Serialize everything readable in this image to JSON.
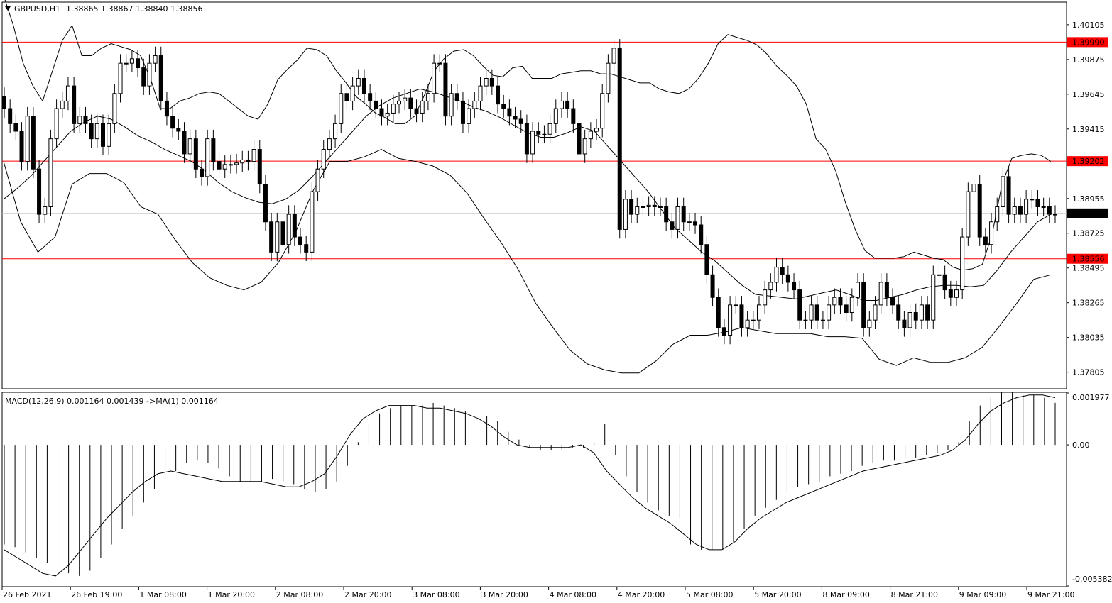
{
  "window": {
    "symbol_title": "GBPUSD,H1",
    "ohlc": "1.38865 1.38867 1.38840 1.38856",
    "indicator_title": "MACD(12,26,9) 0.001164 0.001439  ->MA(1) 0.001164"
  },
  "colors": {
    "background": "#ffffff",
    "candle": "#000000",
    "level_line": "#ff0000",
    "level_label_bg": "#ff0000",
    "current_price_bg": "#000000"
  },
  "chart_data": [
    {
      "type": "candlestick",
      "title": "GBPUSD,H1",
      "ylim": [
        1.377,
        1.4025
      ],
      "y_ticks": [
        "1.40105",
        "1.39875",
        "1.39645",
        "1.39415",
        "1.38955",
        "1.38725",
        "1.38495",
        "1.38265",
        "1.38035",
        "1.37805"
      ],
      "x_ticks": [
        "26 Feb 2021",
        "26 Feb 19:00",
        "1 Mar 08:00",
        "1 Mar 20:00",
        "2 Mar 08:00",
        "2 Mar 20:00",
        "3 Mar 08:00",
        "3 Mar 20:00",
        "4 Mar 08:00",
        "4 Mar 20:00",
        "5 Mar 08:00",
        "5 Mar 20:00",
        "8 Mar 09:00",
        "8 Mar 21:00",
        "9 Mar 09:00",
        "9 Mar 21:00"
      ],
      "levels": [
        {
          "value": 1.3999,
          "label": "1.39990"
        },
        {
          "value": 1.39202,
          "label": "1.39202"
        },
        {
          "value": 1.38556,
          "label": "1.38556"
        }
      ],
      "current_price": {
        "value": 1.38856,
        "label": "1.38856"
      },
      "close": [
        1.3955,
        1.3945,
        1.394,
        1.392,
        1.395,
        1.3915,
        1.3885,
        1.389,
        1.3935,
        1.3955,
        1.396,
        1.397,
        1.3945,
        1.395,
        1.3945,
        1.3935,
        1.3945,
        1.393,
        1.3945,
        1.3965,
        1.3985,
        1.3985,
        1.3988,
        1.3982,
        1.397,
        1.3985,
        1.399,
        1.396,
        1.395,
        1.3942,
        1.394,
        1.3925,
        1.3935,
        1.3915,
        1.391,
        1.3935,
        1.392,
        1.3915,
        1.3918,
        1.3918,
        1.3919,
        1.3921,
        1.392,
        1.3928,
        1.3905,
        1.388,
        1.386,
        1.388,
        1.3865,
        1.3885,
        1.387,
        1.3865,
        1.386,
        1.39,
        1.3915,
        1.3928,
        1.3935,
        1.3945,
        1.3965,
        1.396,
        1.397,
        1.3975,
        1.3965,
        1.396,
        1.3955,
        1.395,
        1.3952,
        1.3958,
        1.396,
        1.3962,
        1.3955,
        1.3952,
        1.396,
        1.3965,
        1.3985,
        1.3985,
        1.395,
        1.3965,
        1.396,
        1.3945,
        1.3955,
        1.396,
        1.397,
        1.3975,
        1.397,
        1.3958,
        1.3955,
        1.395,
        1.3948,
        1.3945,
        1.3925,
        1.394,
        1.3938,
        1.3938,
        1.3945,
        1.3955,
        1.396,
        1.3955,
        1.3945,
        1.3925,
        1.3935,
        1.394,
        1.3942,
        1.3965,
        1.3985,
        1.3995,
        1.3875,
        1.3895,
        1.3885,
        1.389,
        1.389,
        1.3891,
        1.389,
        1.389,
        1.388,
        1.3875,
        1.389,
        1.388,
        1.388,
        1.3878,
        1.3865,
        1.3845,
        1.383,
        1.381,
        1.3805,
        1.3825,
        1.3825,
        1.381,
        1.3815,
        1.3815,
        1.3825,
        1.3835,
        1.384,
        1.385,
        1.3845,
        1.384,
        1.3835,
        1.3815,
        1.3815,
        1.3825,
        1.3815,
        1.3815,
        1.3825,
        1.383,
        1.3825,
        1.382,
        1.383,
        1.384,
        1.381,
        1.3815,
        1.3825,
        1.384,
        1.383,
        1.3825,
        1.3815,
        1.381,
        1.382,
        1.3815,
        1.3825,
        1.3815,
        1.3845,
        1.3845,
        1.3835,
        1.383,
        1.3835,
        1.387,
        1.39,
        1.3905,
        1.387,
        1.3865,
        1.388,
        1.389,
        1.391,
        1.3885,
        1.389,
        1.3885,
        1.3895,
        1.3895,
        1.389,
        1.389,
        1.3885,
        1.3885
      ],
      "upper_band": [
        1.403,
        1.401,
        1.3985,
        1.397,
        1.396,
        1.398,
        1.4,
        1.401,
        1.399,
        1.399,
        1.3995,
        1.3998,
        1.3996,
        1.3994,
        1.399,
        1.3975,
        1.3955,
        1.3955,
        1.396,
        1.3962,
        1.3965,
        1.3966,
        1.3965,
        1.396,
        1.3955,
        1.395,
        1.3948,
        1.3958,
        1.3974,
        1.3981,
        1.3987,
        1.3995,
        1.3994,
        1.399,
        1.398,
        1.3972,
        1.3963,
        1.3958,
        1.3952,
        1.3949,
        1.3945,
        1.3945,
        1.395,
        1.3964,
        1.398,
        1.3988,
        1.3993,
        1.3994,
        1.399,
        1.3983,
        1.3977,
        1.3976,
        1.3982,
        1.3983,
        1.3975,
        1.3975,
        1.3975,
        1.3978,
        1.3979,
        1.398,
        1.398,
        1.3978,
        1.3978,
        1.3976,
        1.3974,
        1.3972,
        1.3972,
        1.3968,
        1.3966,
        1.3965,
        1.3968,
        1.3975,
        1.3985,
        1.3998,
        1.4004,
        1.4002,
        1.4,
        1.3997,
        1.3991,
        1.3983,
        1.3977,
        1.397,
        1.3958,
        1.3935,
        1.3928,
        1.3914,
        1.3893,
        1.3875,
        1.3861,
        1.3856,
        1.3856,
        1.3856,
        1.3857,
        1.386,
        1.3858,
        1.3856,
        1.3855,
        1.385,
        1.3848,
        1.3849,
        1.3852,
        1.3872,
        1.3905,
        1.3922,
        1.3924,
        1.3925,
        1.3924,
        1.392
      ],
      "middle_band": [
        1.3895,
        1.3902,
        1.391,
        1.392,
        1.393,
        1.394,
        1.3946,
        1.395,
        1.3948,
        1.3943,
        1.3937,
        1.3933,
        1.3928,
        1.3924,
        1.392,
        1.3914,
        1.3906,
        1.39,
        1.3896,
        1.3893,
        1.3892,
        1.3895,
        1.3901,
        1.391,
        1.392,
        1.393,
        1.394,
        1.395,
        1.3957,
        1.3962,
        1.3965,
        1.3968,
        1.3966,
        1.3963,
        1.396,
        1.3956,
        1.3953,
        1.3949,
        1.3944,
        1.3939,
        1.3936,
        1.3936,
        1.3939,
        1.3943,
        1.394,
        1.393,
        1.392,
        1.391,
        1.39,
        1.3888,
        1.3876,
        1.3868,
        1.386,
        1.3854,
        1.3846,
        1.3838,
        1.3832,
        1.3831,
        1.383,
        1.3829,
        1.3831,
        1.3833,
        1.3835,
        1.3832,
        1.3828,
        1.3828,
        1.383,
        1.3832,
        1.3835,
        1.3837,
        1.3838,
        1.3838,
        1.3837,
        1.3838,
        1.3848,
        1.386,
        1.387,
        1.388,
        1.3885
      ],
      "lower_band": [
        1.392,
        1.388,
        1.386,
        1.387,
        1.3905,
        1.3912,
        1.3912,
        1.3906,
        1.389,
        1.3885,
        1.3868,
        1.3853,
        1.3843,
        1.3838,
        1.3835,
        1.384,
        1.3853,
        1.3873,
        1.39,
        1.392,
        1.392,
        1.3923,
        1.3928,
        1.3922,
        1.392,
        1.3917,
        1.3911,
        1.3899,
        1.3882,
        1.3866,
        1.3848,
        1.3826,
        1.381,
        1.3795,
        1.3786,
        1.3782,
        1.378,
        1.378,
        1.3788,
        1.3799,
        1.3805,
        1.3805,
        1.3807,
        1.381,
        1.3808,
        1.3806,
        1.3806,
        1.3806,
        1.3804,
        1.3804,
        1.3803,
        1.3789,
        1.3785,
        1.379,
        1.3787,
        1.3787,
        1.379,
        1.3797,
        1.3811,
        1.3826,
        1.3842,
        1.3845
      ]
    },
    {
      "type": "bar",
      "title": "MACD(12,26,9) 0.001164 0.001439  ->MA(1) 0.001164",
      "ylim": [
        -0.005382,
        0.001977
      ],
      "y_ticks": [
        "0.001977",
        "0.00",
        "-0.005382"
      ],
      "series": [
        {
          "name": "MACD",
          "values": [
            -0.0038,
            -0.0039,
            -0.0041,
            -0.0043,
            -0.0045,
            -0.0047,
            -0.0049,
            -0.005,
            -0.0048,
            -0.0043,
            -0.0038,
            -0.0032,
            -0.0027,
            -0.0022,
            -0.0017,
            -0.0013,
            -0.001,
            -0.0007,
            -0.0006,
            -0.0007,
            -0.0009,
            -0.0012,
            -0.0014,
            -0.0014,
            -0.0014,
            -0.0013,
            -0.0014,
            -0.0015,
            -0.0017,
            -0.0018,
            -0.0017,
            -0.0014,
            -0.0008,
            0.0001,
            0.0008,
            0.0012,
            0.0014,
            0.0015,
            0.0015,
            0.0015,
            0.0016,
            0.0015,
            0.0014,
            0.0013,
            0.0012,
            0.0011,
            0.0009,
            0.0005,
            0.0002,
            -0.0001,
            -0.0002,
            -0.0002,
            -0.0002,
            -0.0001,
            -0.0001,
            0.0001,
            0.0008,
            -0.0004,
            -0.0012,
            -0.0018,
            -0.0022,
            -0.0025,
            -0.0027,
            -0.0028,
            -0.0038,
            -0.004,
            -0.004,
            -0.004,
            -0.0037,
            -0.0032,
            -0.0027,
            -0.0024,
            -0.0021,
            -0.0018,
            -0.0016,
            -0.0015,
            -0.0014,
            -0.0012,
            -0.0011,
            -0.001,
            -0.0008,
            -0.0007,
            -0.0006,
            -0.0006,
            -0.0005,
            -0.0005,
            -0.0004,
            -0.0003,
            -0.0002,
            0.0001,
            0.0009,
            0.0015,
            0.0018,
            0.002,
            0.002,
            0.0019,
            0.0019,
            0.0018,
            0.0016
          ]
        },
        {
          "name": "MA(1)",
          "values": [
            -0.004,
            -0.0043,
            -0.0046,
            -0.0049,
            -0.005,
            -0.0046,
            -0.004,
            -0.0034,
            -0.0028,
            -0.0023,
            -0.0018,
            -0.0014,
            -0.0011,
            -0.001,
            -0.0011,
            -0.0012,
            -0.0013,
            -0.0014,
            -0.0014,
            -0.0014,
            -0.0014,
            -0.0015,
            -0.0016,
            -0.0016,
            -0.0014,
            -0.0011,
            -0.0004,
            0.0004,
            0.001,
            0.0013,
            0.0015,
            0.0015,
            0.0015,
            0.0014,
            0.0014,
            0.0013,
            0.0012,
            0.001,
            0.0007,
            0.0003,
            0.0,
            -0.0001,
            -0.0001,
            -0.0001,
            -0.0001,
            0.0,
            -0.0003,
            -0.001,
            -0.0015,
            -0.002,
            -0.0024,
            -0.0027,
            -0.003,
            -0.0034,
            -0.0038,
            -0.004,
            -0.004,
            -0.0037,
            -0.0032,
            -0.0028,
            -0.0025,
            -0.0022,
            -0.002,
            -0.0018,
            -0.0016,
            -0.0014,
            -0.0012,
            -0.001,
            -0.0009,
            -0.0008,
            -0.0007,
            -0.0006,
            -0.0005,
            -0.0004,
            -0.0002,
            0.0002,
            0.0008,
            0.0013,
            0.0016,
            0.0018,
            0.0019,
            0.0019,
            0.0018
          ]
        }
      ]
    }
  ]
}
